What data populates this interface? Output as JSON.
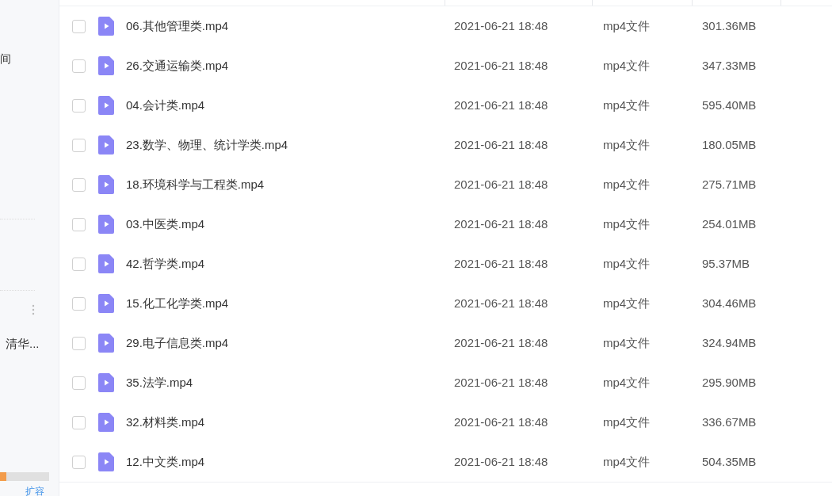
{
  "sidebar": {
    "top_label": "间",
    "folder_label": "清华...",
    "storage": {
      "level": 0.13
    },
    "expand_link": "扩容"
  },
  "files": [
    {
      "name": "06.其他管理类.mp4",
      "modified": "2021-06-21 18:48",
      "type": "mp4文件",
      "size": "301.36MB",
      "checked": false
    },
    {
      "name": "26.交通运输类.mp4",
      "modified": "2021-06-21 18:48",
      "type": "mp4文件",
      "size": "347.33MB",
      "checked": false
    },
    {
      "name": "04.会计类.mp4",
      "modified": "2021-06-21 18:48",
      "type": "mp4文件",
      "size": "595.40MB",
      "checked": false
    },
    {
      "name": "23.数学、物理、统计学类.mp4",
      "modified": "2021-06-21 18:48",
      "type": "mp4文件",
      "size": "180.05MB",
      "checked": false
    },
    {
      "name": "18.环境科学与工程类.mp4",
      "modified": "2021-06-21 18:48",
      "type": "mp4文件",
      "size": "275.71MB",
      "checked": false
    },
    {
      "name": "03.中医类.mp4",
      "modified": "2021-06-21 18:48",
      "type": "mp4文件",
      "size": "254.01MB",
      "checked": false
    },
    {
      "name": "42.哲学类.mp4",
      "modified": "2021-06-21 18:48",
      "type": "mp4文件",
      "size": "95.37MB",
      "checked": false
    },
    {
      "name": "15.化工化学类.mp4",
      "modified": "2021-06-21 18:48",
      "type": "mp4文件",
      "size": "304.46MB",
      "checked": false
    },
    {
      "name": "29.电子信息类.mp4",
      "modified": "2021-06-21 18:48",
      "type": "mp4文件",
      "size": "324.94MB",
      "checked": false
    },
    {
      "name": "35.法学.mp4",
      "modified": "2021-06-21 18:48",
      "type": "mp4文件",
      "size": "295.90MB",
      "checked": false
    },
    {
      "name": "32.材料类.mp4",
      "modified": "2021-06-21 18:48",
      "type": "mp4文件",
      "size": "336.67MB",
      "checked": false
    },
    {
      "name": "12.中文类.mp4",
      "modified": "2021-06-21 18:48",
      "type": "mp4文件",
      "size": "504.35MB",
      "checked": false
    }
  ]
}
